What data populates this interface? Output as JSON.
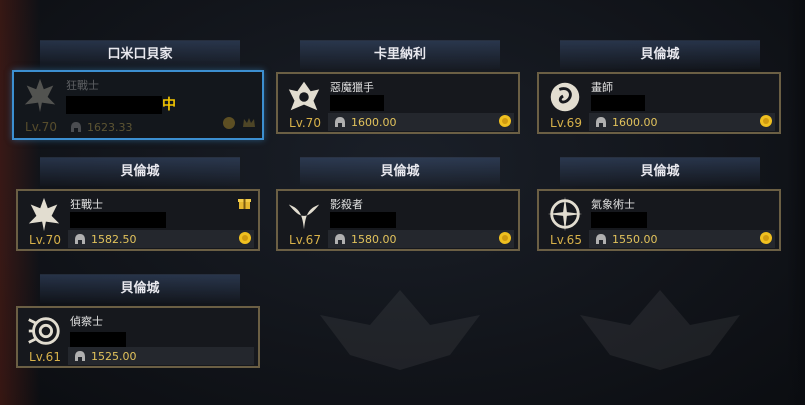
{
  "groups": [
    {
      "server": "口米口貝家",
      "class": "狂戰士",
      "level": "Lv.70",
      "power": "1623.33",
      "overlay_text": "中",
      "selected": true
    },
    {
      "server": "卡里納利",
      "class": "惡魔獵手",
      "level": "Lv.70",
      "power": "1600.00"
    },
    {
      "server": "貝倫城",
      "class": "畫師",
      "level": "Lv.69",
      "power": "1600.00"
    },
    {
      "server": "貝倫城",
      "class": "狂戰士",
      "level": "Lv.70",
      "power": "1582.50",
      "gift": true
    },
    {
      "server": "貝倫城",
      "class": "影殺者",
      "level": "Lv.67",
      "power": "1580.00"
    },
    {
      "server": "貝倫城",
      "class": "氣象術士",
      "level": "Lv.65",
      "power": "1550.00"
    },
    {
      "server": "貝倫城",
      "class": "偵察士",
      "level": "Lv.61",
      "power": "1525.00"
    }
  ],
  "colors": {
    "accent_gold": "#d7b14a",
    "selected_border": "#3c8fd0",
    "card_border": "#6b5f44"
  }
}
